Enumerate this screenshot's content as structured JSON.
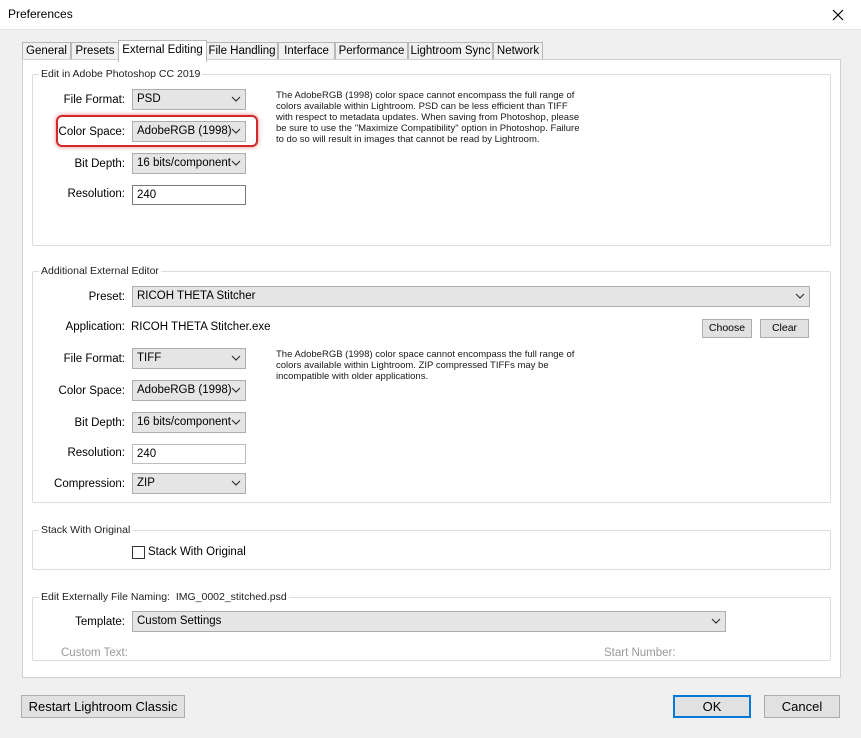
{
  "window": {
    "title": "Preferences"
  },
  "tabs": [
    {
      "label": "General"
    },
    {
      "label": "Presets"
    },
    {
      "label": "External Editing"
    },
    {
      "label": "File Handling"
    },
    {
      "label": "Interface"
    },
    {
      "label": "Performance"
    },
    {
      "label": "Lightroom Sync"
    },
    {
      "label": "Network"
    }
  ],
  "active_tab": "External Editing",
  "photoshop": {
    "group_label": "Edit in Adobe Photoshop CC 2019",
    "file_format": {
      "label": "File Format:",
      "value": "PSD"
    },
    "color_space": {
      "label": "Color Space:",
      "value": "AdobeRGB (1998)"
    },
    "bit_depth": {
      "label": "Bit Depth:",
      "value": "16 bits/component"
    },
    "resolution": {
      "label": "Resolution:",
      "value": "240"
    },
    "description": "The AdobeRGB (1998) color space cannot encompass the full range of colors available within Lightroom. PSD can be less efficient than TIFF with respect to metadata updates. When saving from Photoshop, please be sure to use the \"Maximize Compatibility\" option in Photoshop. Failure to do so will result in images that cannot be read by Lightroom."
  },
  "additional": {
    "group_label": "Additional External Editor",
    "preset": {
      "label": "Preset:",
      "value": "RICOH THETA Stitcher"
    },
    "application": {
      "label": "Application:",
      "value": "RICOH THETA Stitcher.exe"
    },
    "choose_label": "Choose",
    "clear_label": "Clear",
    "file_format": {
      "label": "File Format:",
      "value": "TIFF"
    },
    "color_space": {
      "label": "Color Space:",
      "value": "AdobeRGB (1998)"
    },
    "bit_depth": {
      "label": "Bit Depth:",
      "value": "16 bits/component"
    },
    "resolution": {
      "label": "Resolution:",
      "value": "240"
    },
    "compression": {
      "label": "Compression:",
      "value": "ZIP"
    },
    "description": "The AdobeRGB (1998) color space cannot encompass the full range of colors available within Lightroom. ZIP compressed TIFFs may be incompatible with older applications."
  },
  "stack": {
    "group_label": "Stack With Original",
    "checkbox_label": "Stack With Original",
    "checked": false
  },
  "naming": {
    "group_label": "Edit Externally File Naming:",
    "example": "IMG_0002_stitched.psd",
    "template": {
      "label": "Template:",
      "value": "Custom Settings"
    },
    "custom_text_label": "Custom Text:",
    "start_number_label": "Start Number:"
  },
  "footer": {
    "restart_label": "Restart Lightroom Classic",
    "ok_label": "OK",
    "cancel_label": "Cancel"
  },
  "colors": {
    "accent": "#0078d7",
    "highlight": "#d12a2a"
  },
  "icons": {
    "close": "close-icon",
    "dropdown": "chevron-down-icon"
  }
}
